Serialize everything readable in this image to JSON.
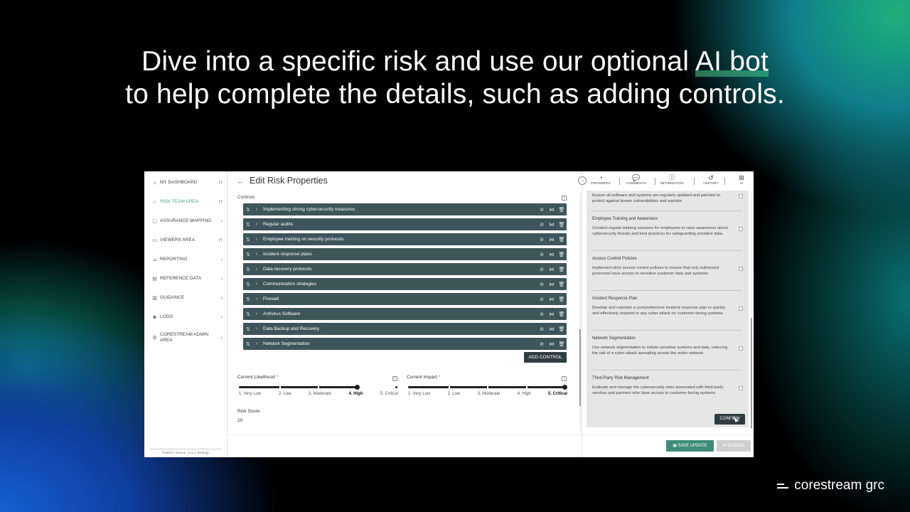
{
  "headline": {
    "line1_pre": "Dive into a specific risk and use our optional ",
    "line1_highlight": "AI bot",
    "line2": "to help complete the details, such as adding controls."
  },
  "brand": {
    "name": "corestream grc"
  },
  "sidebar": {
    "items": [
      {
        "label": "MY DASHBOARD",
        "icon": "bell-icon",
        "end": "bookmark-icon"
      },
      {
        "label": "RISK TEAM AREA",
        "icon": "users-icon",
        "end": "bookmark-icon"
      },
      {
        "label": "ASSURANCE MAPPING",
        "icon": "square-icon",
        "end": "chevron-right-icon"
      },
      {
        "label": "VIEWERS AREA",
        "icon": "window-icon",
        "end": "bookmark-icon"
      },
      {
        "label": "REPORTING",
        "icon": "chart-icon",
        "end": "chevron-right-icon"
      },
      {
        "label": "REFERENCE DATA",
        "icon": "database-icon",
        "end": "chevron-right-icon"
      },
      {
        "label": "GUIDANCE",
        "icon": "book-icon",
        "end": "chevron-right-icon"
      },
      {
        "label": "LOGS",
        "icon": "person-icon",
        "end": "chevron-right-icon"
      },
      {
        "label": "CORESTREAM ADMIN AREA",
        "icon": "gears-icon",
        "end": "chevron-right-icon"
      }
    ],
    "version": "Platform Version: 3.12.1 (Debug)"
  },
  "main": {
    "title": "Edit Risk Properties",
    "controls_label": "Controls",
    "controls": [
      "Implementing strong cybersecurity measures",
      "Regular audits",
      "Employee training on security protocols",
      "Incident response plans",
      "Data recovery protocols",
      "Communication strategies",
      "Firewall",
      "Antivirus Software",
      "Data Backup and Recovery",
      "Network Segmentation"
    ],
    "add_control": "ADD CONTROL",
    "likelihood": {
      "label": "Current Likelihood",
      "required": "*",
      "options": [
        "1. Very Low",
        "2. Low",
        "3. Moderate",
        "4. High",
        "5. Critical"
      ],
      "selected_index": 3
    },
    "impact": {
      "label": "Current Impact",
      "required": "*",
      "options": [
        "1. Very Low",
        "2. Low",
        "3. Moderate",
        "4. High",
        "5. Critical"
      ],
      "selected_index": 4
    },
    "risk_score_label": "Risk Score",
    "risk_score": "20"
  },
  "right_panel": {
    "tabs": [
      {
        "label": "PROGRESS",
        "icon": "progress-icon",
        "glyph": "◔"
      },
      {
        "label": "COMMENTS",
        "icon": "comments-icon",
        "glyph": "💬"
      },
      {
        "label": "INFORMATION",
        "icon": "info-icon",
        "glyph": "ⓘ"
      },
      {
        "label": "HISTORY",
        "icon": "history-icon",
        "glyph": "↺"
      },
      {
        "label": "AI",
        "icon": "ai-icon",
        "glyph": "⊞"
      }
    ],
    "top_partial_desc": "Ensure all software and systems are regularly updated and patched to protect against known vulnerabilities and exploits.",
    "suggestions": [
      {
        "title": "Employee Training and Awareness",
        "desc": "Conduct regular training sessions for employees to raise awareness about cybersecurity threats and best practices for safeguarding sensitive data."
      },
      {
        "title": "Access Control Policies",
        "desc": "Implement strict access control policies to ensure that only authorized personnel have access to sensitive customer data and systems."
      },
      {
        "title": "Incident Response Plan",
        "desc": "Develop and maintain a comprehensive incident response plan to quickly and effectively respond to any cyber attack on customer-facing systems."
      },
      {
        "title": "Network Segmentation",
        "desc": "Use network segmentation to isolate sensitive systems and data, reducing the risk of a cyber attack spreading across the entire network."
      },
      {
        "title": "Third-Party Risk Management",
        "desc": "Evaluate and manage the cybersecurity risks associated with third-party vendors and partners who have access to customer-facing systems."
      }
    ],
    "confirm": "CONFIRM",
    "save_update": "SAVE UPDATE",
    "cancel": "CANCEL"
  },
  "colors": {
    "control_row": "#3e5559",
    "active_nav": "#4aa587",
    "save_button": "#3f8c78",
    "highlight": "#46c88c"
  }
}
